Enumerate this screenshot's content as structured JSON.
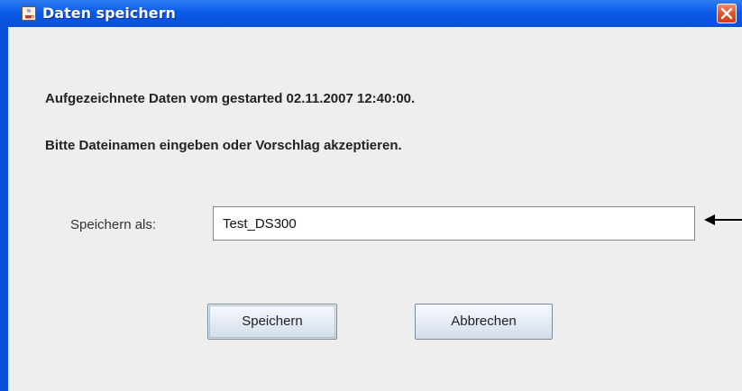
{
  "window": {
    "title": "Daten speichern",
    "app_icon": "java-cup-icon",
    "close_icon": "close-icon"
  },
  "dialog": {
    "line1": "Aufgezeichnete Daten vom gestarted 02.11.2007 12:40:00.",
    "line2": "Bitte Dateinamen eingeben oder Vorschlag akzeptieren.",
    "field_label": "Speichern als:",
    "filename_value": "Test_DS300",
    "arrow_icon": "left-arrow-icon"
  },
  "buttons": {
    "save_label": "Speichern",
    "cancel_label": "Abbrechen"
  },
  "colors": {
    "titlebar": "#0a50d8",
    "close_button": "#e2542c",
    "background": "#eeeeee"
  }
}
